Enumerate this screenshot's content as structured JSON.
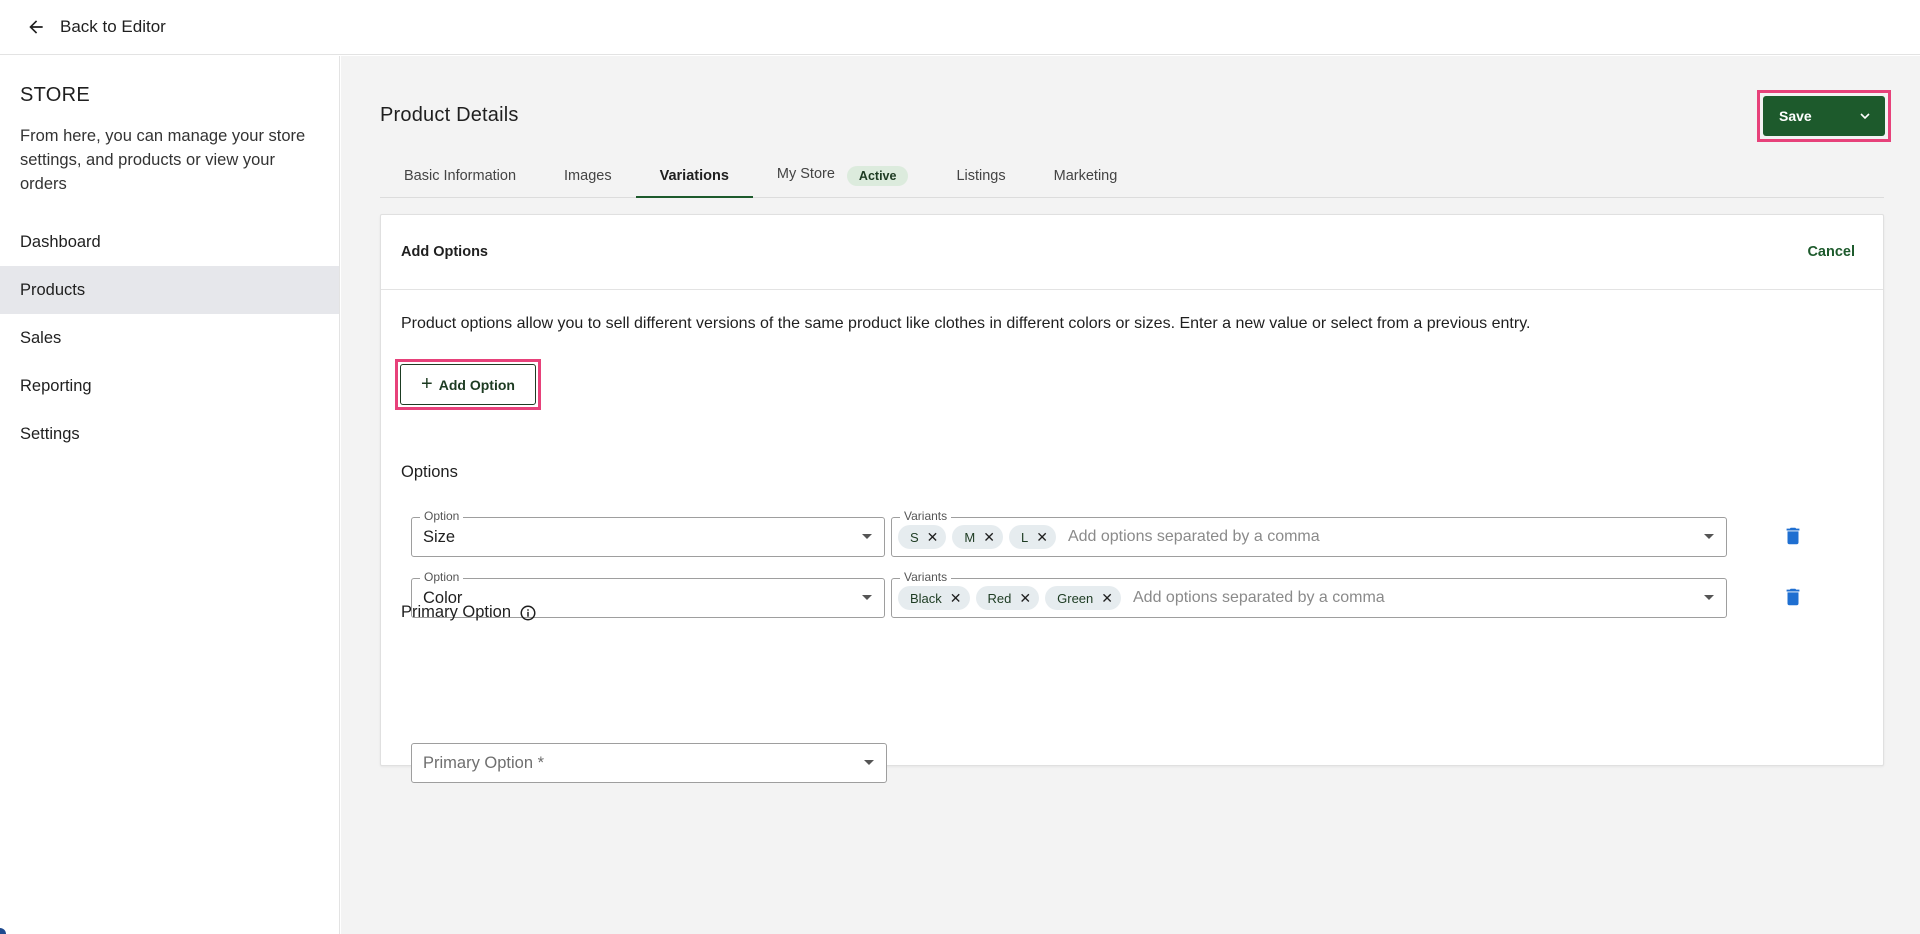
{
  "topbar": {
    "back_label": "Back to Editor"
  },
  "sidebar": {
    "title": "STORE",
    "description": "From here, you can manage your store settings, and products or view your orders",
    "items": [
      {
        "label": "Dashboard"
      },
      {
        "label": "Products",
        "active": true
      },
      {
        "label": "Sales"
      },
      {
        "label": "Reporting"
      },
      {
        "label": "Settings"
      }
    ]
  },
  "header": {
    "title": "Product Details",
    "save_label": "Save"
  },
  "tabs": [
    {
      "label": "Basic Information"
    },
    {
      "label": "Images"
    },
    {
      "label": "Variations",
      "active": true
    },
    {
      "label": "My Store",
      "badge": "Active"
    },
    {
      "label": "Listings"
    },
    {
      "label": "Marketing"
    }
  ],
  "card": {
    "title": "Add Options",
    "cancel_label": "Cancel",
    "description": "Product options allow you to sell different versions of the same product like clothes in different colors or sizes. Enter a new value or select from a previous entry.",
    "add_option_label": "Add Option",
    "options_label": "Options",
    "option_legend": "Option",
    "variants_legend": "Variants",
    "variants_placeholder": "Add options separated by a comma",
    "rows": [
      {
        "option": "Size",
        "variants": [
          "S",
          "M",
          "L"
        ]
      },
      {
        "option": "Color",
        "variants": [
          "Black",
          "Red",
          "Green"
        ]
      }
    ],
    "primary_option_label": "Primary Option",
    "primary_option_placeholder": "Primary Option *"
  },
  "colors": {
    "accent": "#1d5a2c",
    "highlight": "#e7417a",
    "trash": "#1f6fd1"
  },
  "icons": {
    "back": "arrow-left-icon",
    "save_menu": "chevron-down-icon",
    "delete": "trash-icon",
    "info": "info-icon",
    "add": "plus-icon"
  }
}
